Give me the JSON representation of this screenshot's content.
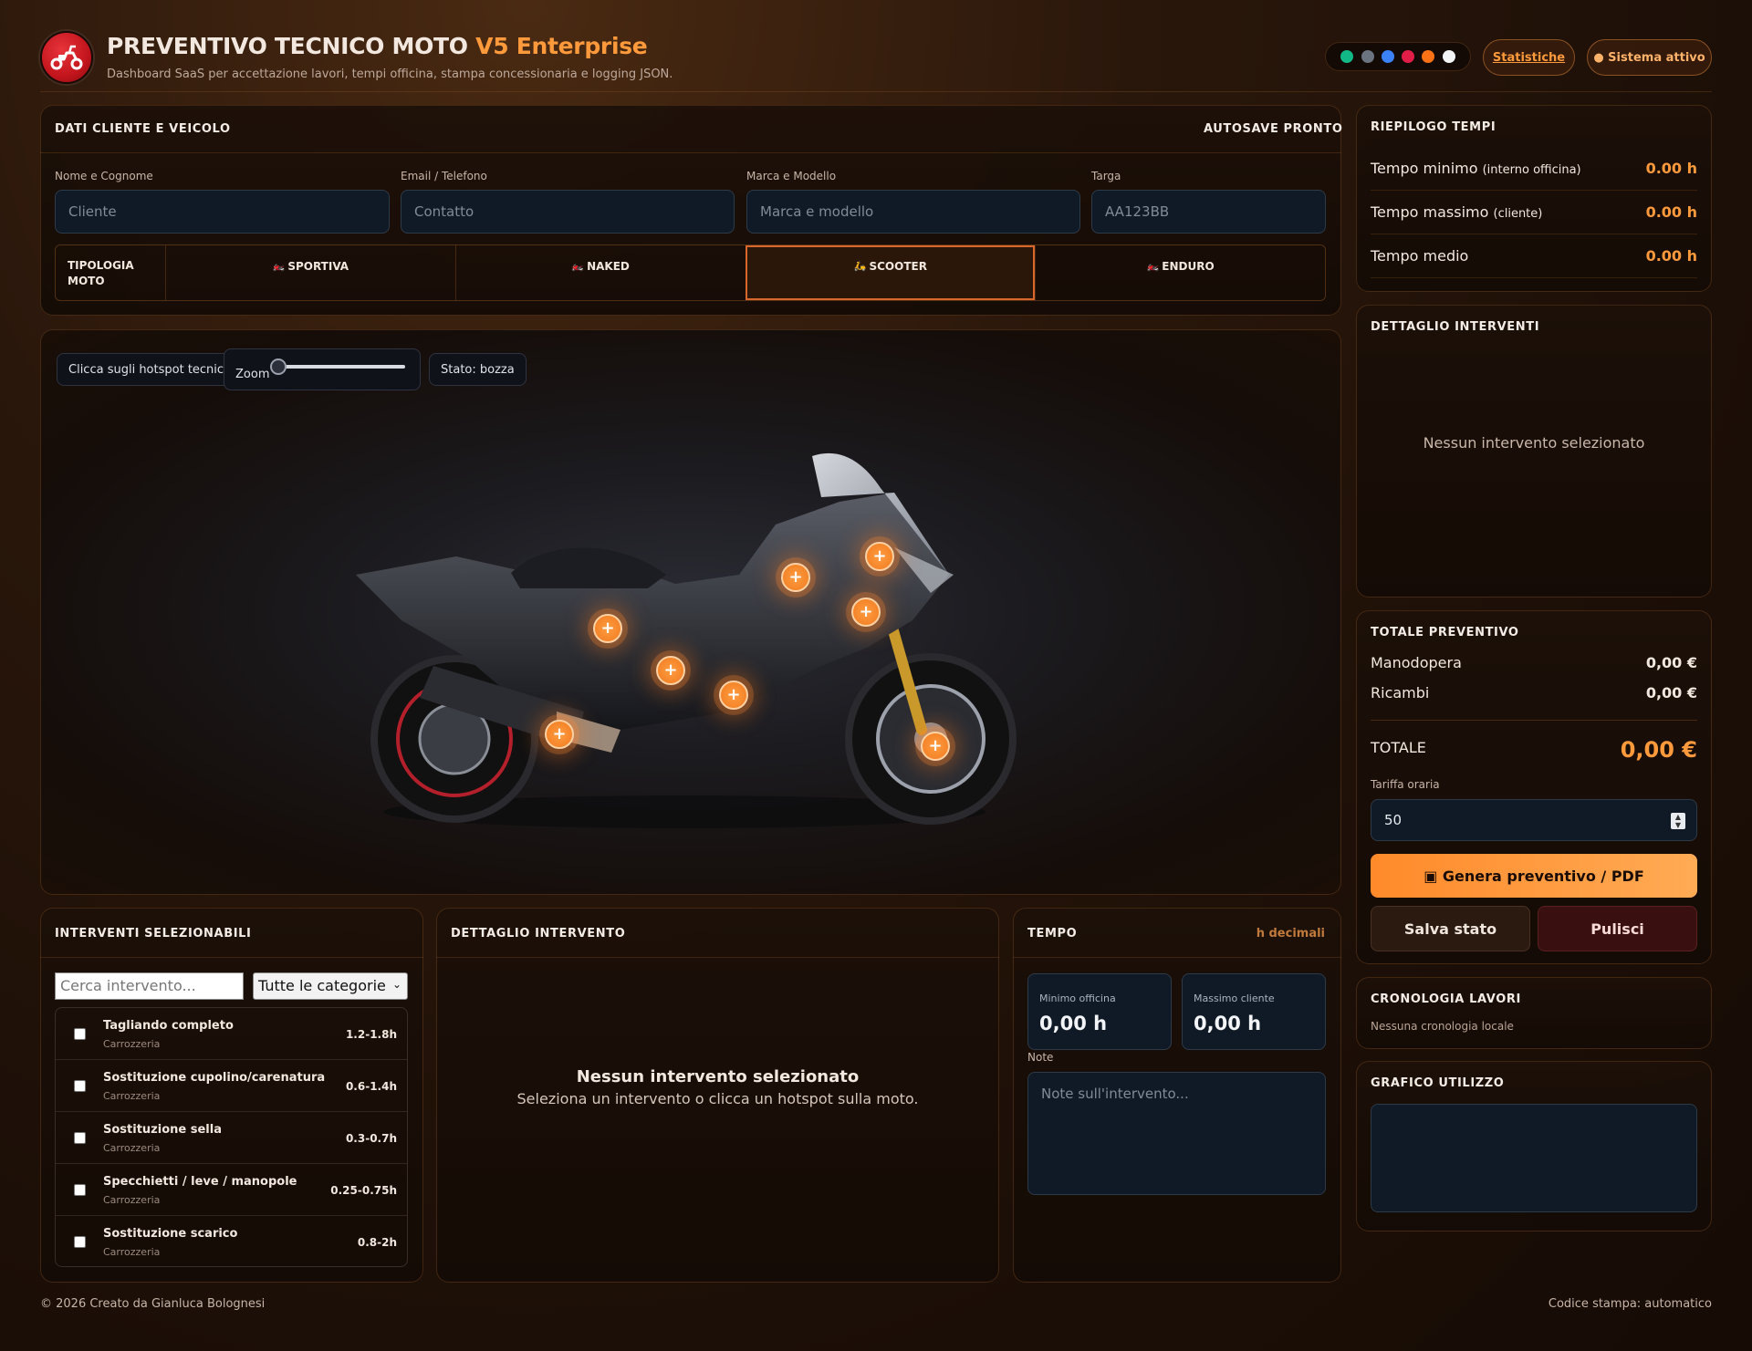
{
  "header": {
    "title_main": "PREVENTIVO TECNICO MOTO",
    "title_version": "V5 Enterprise",
    "subtitle": "Dashboard SaaS per accettazione lavori, tempi officina, stampa concessionaria e logging JSON.",
    "theme_swatches": [
      "#12b886",
      "#6b7280",
      "#3b82f6",
      "#e11d48",
      "#f97316",
      "#f3f4f6"
    ],
    "stats_button": "Statistiche",
    "system_status": "● Sistema attivo"
  },
  "client": {
    "title": "DATI CLIENTE E VEICOLO",
    "autosave": "AUTOSAVE PRONTO",
    "fields": [
      {
        "label": "Nome e Cognome",
        "placeholder": "Cliente"
      },
      {
        "label": "Email / Telefono",
        "placeholder": "Contatto"
      },
      {
        "label": "Marca e Modello",
        "placeholder": "Marca e modello"
      },
      {
        "label": "Targa",
        "placeholder": "AA123BB"
      }
    ],
    "type_label_1": "TIPOLOGIA",
    "type_label_2": "MOTO",
    "types": [
      {
        "icon": "🏍️",
        "label": "SPORTIVA",
        "active": false
      },
      {
        "icon": "🏍️",
        "label": "NAKED",
        "active": false
      },
      {
        "icon": "🛵",
        "label": "SCOOTER",
        "active": true
      },
      {
        "icon": "🏍️",
        "label": "ENDURO",
        "active": false
      }
    ]
  },
  "viewer": {
    "hint": "Clicca sugli hotspot tecnici",
    "zoom_label": "Zoom",
    "zoom_value": 0,
    "status": "Stato: bozza",
    "hotspot_symbol": "+"
  },
  "summary": {
    "title": "RIEPILOGO TEMPI",
    "rows": [
      {
        "label": "Tempo minimo",
        "note": "(interno officina)",
        "value": "0.00 h"
      },
      {
        "label": "Tempo massimo",
        "note": "(cliente)",
        "value": "0.00 h"
      },
      {
        "label": "Tempo medio",
        "note": "",
        "value": "0.00 h"
      }
    ]
  },
  "details": {
    "title": "DETTAGLIO INTERVENTI",
    "empty": "Nessun intervento selezionato"
  },
  "total": {
    "title": "TOTALE PREVENTIVO",
    "labor_label": "Manodopera",
    "labor_value": "0,00 €",
    "parts_label": "Ricambi",
    "parts_value": "0,00 €",
    "total_label": "TOTALE",
    "total_value": "0,00 €",
    "rate_label": "Tariffa oraria",
    "rate_value": "50",
    "generate_button": "▣ Genera preventivo / PDF",
    "save_button": "Salva stato",
    "clear_button": "Pulisci"
  },
  "history": {
    "title": "CRONOLOGIA LAVORI",
    "empty": "Nessuna cronologia locale"
  },
  "usage_chart": {
    "title": "GRAFICO UTILIZZO"
  },
  "interventions": {
    "title": "INTERVENTI SELEZIONABILI",
    "search_placeholder": "Cerca intervento...",
    "category_selected": "Tutte le categorie",
    "items": [
      {
        "name": "Tagliando completo",
        "category": "Carrozzeria",
        "time": "1.2-1.8h"
      },
      {
        "name": "Sostituzione cupolino/carenatura",
        "category": "Carrozzeria",
        "time": "0.6-1.4h"
      },
      {
        "name": "Sostituzione sella",
        "category": "Carrozzeria",
        "time": "0.3-0.7h"
      },
      {
        "name": "Specchietti / leve / manopole",
        "category": "Carrozzeria",
        "time": "0.25-0.75h"
      },
      {
        "name": "Sostituzione scarico",
        "category": "Carrozzeria",
        "time": "0.8-2h"
      }
    ]
  },
  "intervention_detail": {
    "title": "DETTAGLIO INTERVENTO",
    "empty_title": "Nessun intervento selezionato",
    "empty_sub": "Seleziona un intervento o clicca un hotspot sulla moto."
  },
  "time_panel": {
    "title": "TEMPO",
    "unit": "h decimali",
    "min_label": "Minimo officina",
    "min_value": "0,00 h",
    "max_label": "Massimo cliente",
    "max_value": "0,00 h",
    "notes_label": "Note",
    "notes_placeholder": "Note sull'intervento..."
  },
  "footer": {
    "credit": "© 2026 Creato da Gianluca Bolognesi",
    "print_code": "Codice stampa: automatico"
  }
}
